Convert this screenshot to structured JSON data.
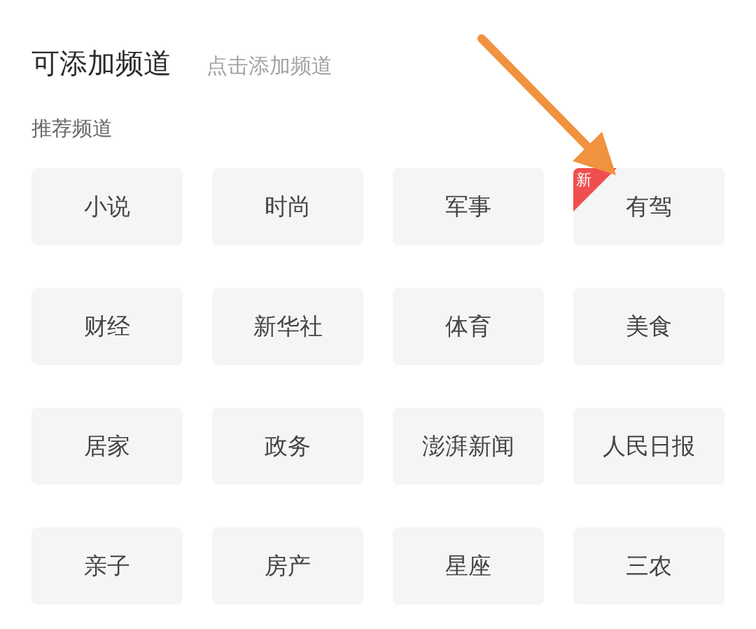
{
  "header": {
    "title": "可添加频道",
    "hint": "点击添加频道"
  },
  "section": {
    "title": "推荐频道"
  },
  "channels": [
    {
      "label": "小说"
    },
    {
      "label": "时尚"
    },
    {
      "label": "军事"
    },
    {
      "label": "有驾",
      "badge": "新"
    },
    {
      "label": "财经"
    },
    {
      "label": "新华社"
    },
    {
      "label": "体育"
    },
    {
      "label": "美食"
    },
    {
      "label": "居家"
    },
    {
      "label": "政务"
    },
    {
      "label": "澎湃新闻"
    },
    {
      "label": "人民日报"
    },
    {
      "label": "亲子"
    },
    {
      "label": "房产"
    },
    {
      "label": "星座"
    },
    {
      "label": "三农"
    }
  ],
  "annotations": [
    {
      "kind": "arrow"
    }
  ]
}
